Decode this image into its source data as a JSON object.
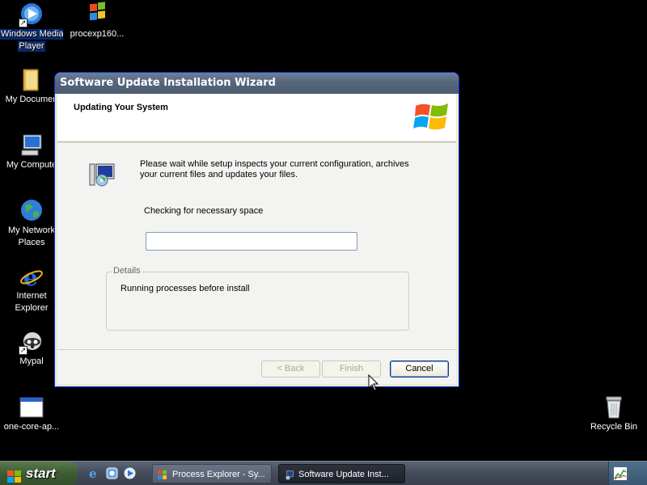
{
  "desktop": {
    "icons": [
      {
        "label_line1": "Windows Media",
        "label_line2": "Player",
        "icon": "media-player-icon"
      },
      {
        "label_line1": "procexp160...",
        "label_line2": "",
        "icon": "process-explorer-icon"
      },
      {
        "label_line1": "My Documen",
        "label_line2": "",
        "icon": "folder-icon"
      },
      {
        "label_line1": "My Compute",
        "label_line2": "",
        "icon": "computer-icon"
      },
      {
        "label_line1": "My Network",
        "label_line2": "Places",
        "icon": "network-icon"
      },
      {
        "label_line1": "Internet",
        "label_line2": "Explorer",
        "icon": "ie-icon"
      },
      {
        "label_line1": "Mypal",
        "label_line2": "",
        "icon": "mypal-icon"
      },
      {
        "label_line1": "one-core-ap...",
        "label_line2": "",
        "icon": "window-app-icon"
      },
      {
        "label_line1": "Recycle Bin",
        "label_line2": "",
        "icon": "recycle-bin-icon"
      }
    ]
  },
  "wizard": {
    "title": "Software Update Installation Wizard",
    "header_title": "Updating Your System",
    "description": "Please wait while setup inspects your current configuration, archives your current files and updates your files.",
    "status": "Checking for necessary space",
    "progress_percent": 0,
    "details_legend": "Details",
    "details_text": "Running processes before install",
    "buttons": {
      "back": "< Back",
      "finish": "Finish",
      "cancel": "Cancel"
    }
  },
  "taskbar": {
    "start_label": "start",
    "tasks": [
      {
        "label": "Process Explorer - Sy..."
      },
      {
        "label": "Software Update Inst..."
      }
    ]
  },
  "colors": {
    "desktop": "#000000",
    "titlebar": "#56677d",
    "taskbar": "#444c59"
  }
}
